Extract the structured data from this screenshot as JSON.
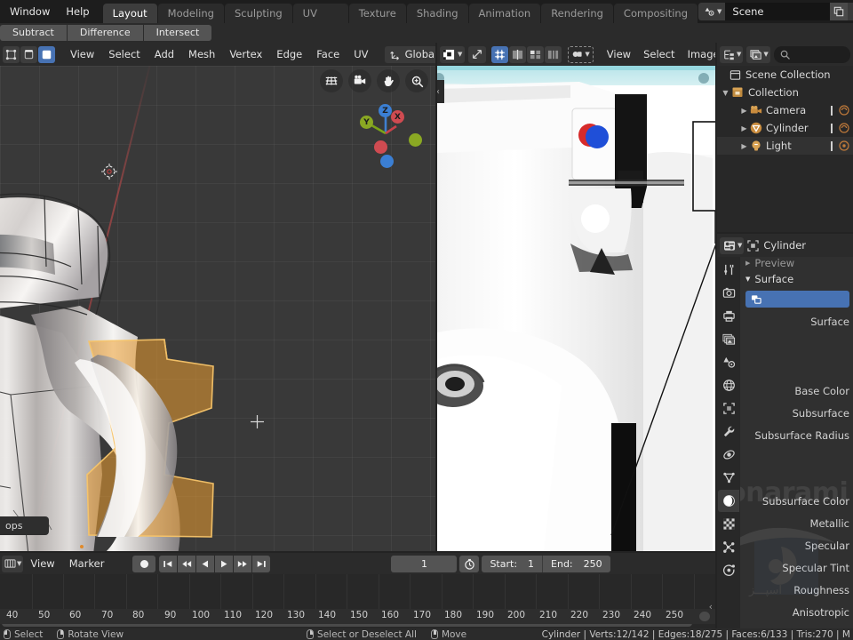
{
  "topbar": {
    "menus": [
      "Window",
      "Help"
    ],
    "workspace_tabs": [
      {
        "label": "Layout",
        "active": true
      },
      {
        "label": "Modeling",
        "active": false
      },
      {
        "label": "Sculpting",
        "active": false
      },
      {
        "label": "UV Editing",
        "active": false
      },
      {
        "label": "Texture Paint",
        "active": false
      },
      {
        "label": "Shading",
        "active": false
      },
      {
        "label": "Animation",
        "active": false
      },
      {
        "label": "Rendering",
        "active": false
      },
      {
        "label": "Compositing",
        "active": false
      }
    ],
    "scene_name": "Scene",
    "scene_icon": "scene-icon",
    "new_scene_icon": "duplicate-icon",
    "unlink_scene_icon": "close-icon",
    "viewlayer_icon": "view-layer-icon"
  },
  "boolean_bar": {
    "buttons": [
      "Subtract",
      "Difference",
      "Intersect"
    ]
  },
  "viewport": {
    "mode_buttons": [
      {
        "name": "vertex-select-mode",
        "active": false
      },
      {
        "name": "edge-select-mode",
        "active": false
      },
      {
        "name": "face-select-mode",
        "active": true
      }
    ],
    "menus": [
      "View",
      "Select",
      "Add",
      "Mesh",
      "Vertex",
      "Edge",
      "Face",
      "UV"
    ],
    "transform_orientation": "Global",
    "gizmo_buttons": [
      "grid-gizmo-icon",
      "camera-gizmo-icon",
      "hand-pan-icon",
      "zoom-magnifier-icon"
    ],
    "axis_labels": {
      "z": "Z",
      "y": "Y",
      "x": "X"
    },
    "operator_panel": "ops"
  },
  "image_editor": {
    "editor_type_icon": "image-editor-icon",
    "uv_mode_icon": "uv-sync-icon",
    "select_mode_buttons": [
      {
        "name": "uv-vertex-select",
        "active": true
      },
      {
        "name": "uv-edge-select",
        "active": false
      },
      {
        "name": "uv-face-select",
        "active": false
      },
      {
        "name": "uv-island-select",
        "active": false
      }
    ],
    "pivot_icon": "pivot-point-icon",
    "menus": [
      "View",
      "Select",
      "Image"
    ]
  },
  "outliner": {
    "display_mode_icon": "outliner-icon",
    "filter_icon": "filter-icon",
    "search_placeholder": "",
    "rows": [
      {
        "label": "Scene Collection",
        "indent": 0,
        "icon": "scene-collection-icon",
        "expandable": false,
        "highlight": false
      },
      {
        "label": "Collection",
        "indent": 1,
        "icon": "collection-icon",
        "expandable": true,
        "highlight": false
      },
      {
        "label": "Camera",
        "indent": 2,
        "icon": "camera-icon",
        "expandable": true,
        "highlight": false
      },
      {
        "label": "Cylinder",
        "indent": 2,
        "icon": "mesh-data-icon",
        "expandable": true,
        "highlight": false
      },
      {
        "label": "Light",
        "indent": 2,
        "icon": "light-icon",
        "expandable": true,
        "highlight": true
      }
    ]
  },
  "properties": {
    "editor_icon": "properties-editor-icon",
    "breadcrumb_object": "Cylinder",
    "tabs": [
      {
        "name": "tool-tab",
        "icon": "tool-icon",
        "active": false
      },
      {
        "name": "render-tab",
        "icon": "render-camera-icon",
        "active": false
      },
      {
        "name": "output-tab",
        "icon": "printer-icon",
        "active": false
      },
      {
        "name": "view-layer-tab",
        "icon": "images-icon",
        "active": false
      },
      {
        "name": "scene-tab",
        "icon": "scene-cone-icon",
        "active": false
      },
      {
        "name": "world-tab",
        "icon": "world-globe-icon",
        "active": false
      },
      {
        "name": "object-tab",
        "icon": "object-square-icon",
        "active": false
      },
      {
        "name": "modifier-tab",
        "icon": "wrench-icon",
        "active": false
      },
      {
        "name": "particles-tab",
        "icon": "physics-icon",
        "active": false
      },
      {
        "name": "data-tab",
        "icon": "mesh-triangle-icon",
        "active": false
      },
      {
        "name": "material-tab",
        "icon": "material-sphere-icon",
        "active": true
      },
      {
        "name": "texture-tab",
        "icon": "checker-icon",
        "active": false
      },
      {
        "name": "constraint-tab",
        "icon": "constraint-icon",
        "active": false
      },
      {
        "name": "physics-tab",
        "icon": "orbit-icon",
        "active": false
      }
    ],
    "sections": [
      {
        "label": "Preview",
        "expanded": false
      },
      {
        "label": "Surface",
        "expanded": true
      }
    ],
    "node_button": "",
    "properties_list": [
      "Surface",
      "Base Color",
      "Subsurface",
      "Subsurface Radius",
      "Subsurface Color",
      "Metallic",
      "Specular",
      "Specular Tint",
      "Roughness",
      "Anisotropic"
    ],
    "watermark_text": "onarami",
    "watermark_sub": "آسپـــز"
  },
  "timeline": {
    "editor_icon": "timeline-icon",
    "menus": [
      "View",
      "Marker"
    ],
    "playback_buttons": [
      "record-icon",
      "jump-start-icon",
      "prev-keyframe-icon",
      "play-reverse-icon",
      "play-icon",
      "next-keyframe-icon",
      "jump-end-icon"
    ],
    "current_frame": "1",
    "start_label": "Start:",
    "start_value": "1",
    "end_label": "End:",
    "end_value": "250",
    "ruler_ticks": [
      "40",
      "50",
      "60",
      "70",
      "80",
      "90",
      "100",
      "110",
      "120",
      "130",
      "140",
      "150",
      "160",
      "170",
      "180",
      "190",
      "200",
      "210",
      "220",
      "230",
      "240",
      "250"
    ]
  },
  "statusbar": {
    "items": [
      {
        "icon": "mouse-left-icon",
        "label": "Select"
      },
      {
        "icon": "mouse-middle-icon",
        "label": "Rotate View"
      },
      {
        "icon": "mouse-right-icon",
        "label": "Select or Deselect All"
      },
      {
        "icon": "mouse-drag-icon",
        "label": "Move"
      }
    ],
    "stats": "Cylinder | Verts:12/142 | Edges:18/275 | Faces:6/133 | Tris:270 | M"
  },
  "colors": {
    "accent_blue": "#4772b3",
    "header_bg": "#2b2b2b",
    "panel_bg": "#303030",
    "viewport_bg": "#393939",
    "select_orange": "#ed9e32"
  }
}
